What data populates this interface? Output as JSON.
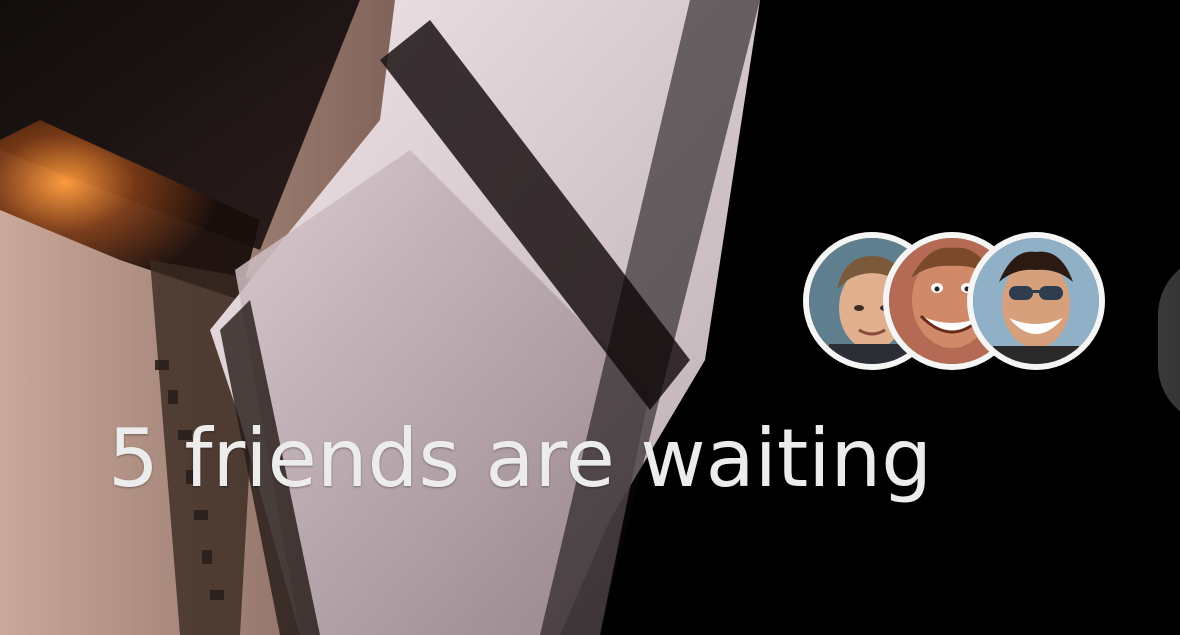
{
  "waiting": {
    "headline": "5 friends are waiting",
    "avatars": [
      {
        "name": "friend-1",
        "style": "photo",
        "bg": "#5f7f8e"
      },
      {
        "name": "friend-2",
        "style": "caricature",
        "bg": "#b56a55"
      },
      {
        "name": "friend-3",
        "style": "caricature-sunglasses",
        "bg": "#8fb0c6"
      }
    ]
  },
  "colors": {
    "background": "#000000",
    "text": "#ececec",
    "avatar_border": "#f5f5f5"
  }
}
